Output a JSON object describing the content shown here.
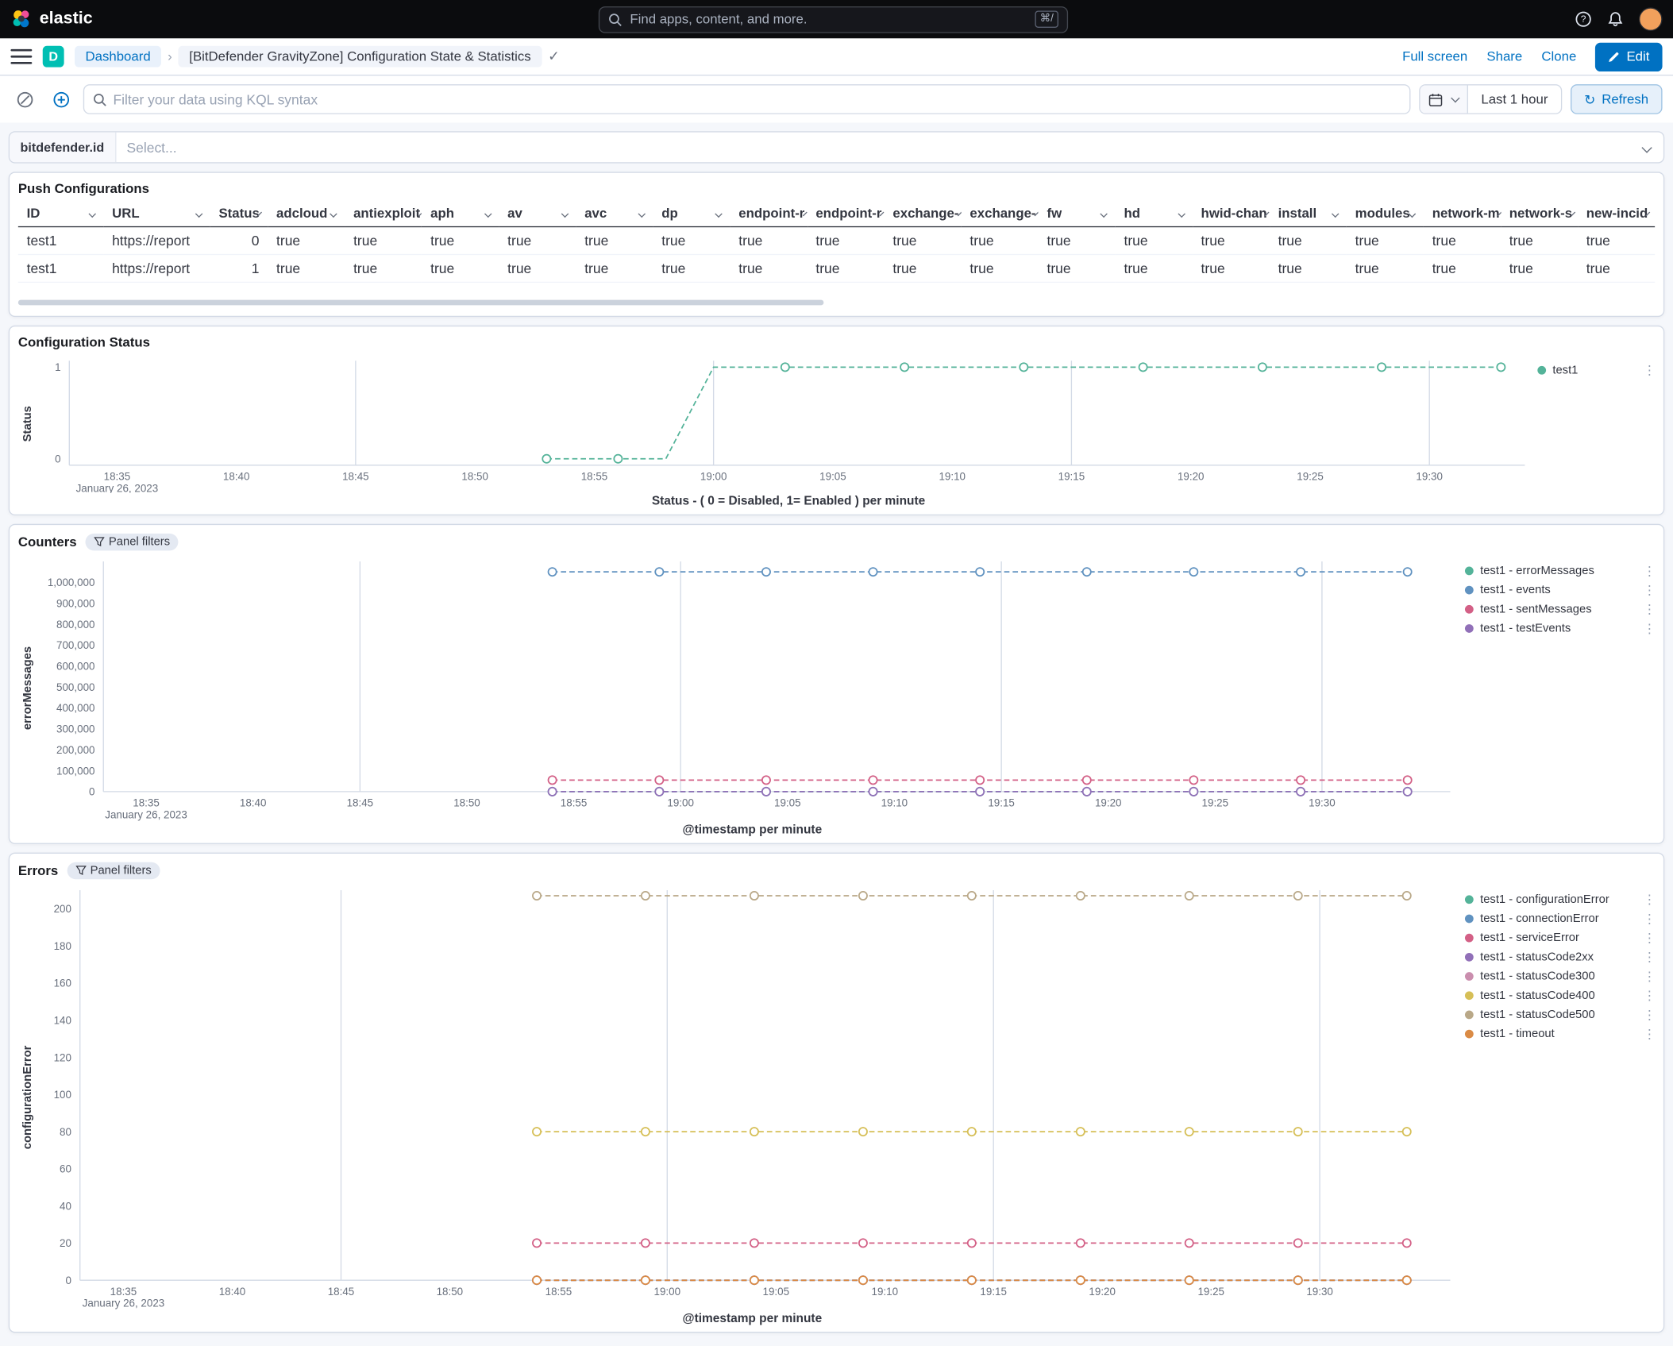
{
  "topbar": {
    "brand": "elastic",
    "search_placeholder": "Find apps, content, and more.",
    "search_shortcut": "⌘/"
  },
  "navbar": {
    "space_initial": "D",
    "breadcrumb_dashboard": "Dashboard",
    "breadcrumb_title": "[BitDefender GravityZone] Configuration State & Statistics",
    "full_screen": "Full screen",
    "share": "Share",
    "clone": "Clone",
    "edit": "Edit"
  },
  "filter_bar": {
    "kql_placeholder": "Filter your data using KQL syntax",
    "time_range": "Last 1 hour",
    "refresh": "Refresh"
  },
  "controls": {
    "field_label": "bitdefender.id",
    "placeholder": "Select..."
  },
  "icons": {
    "refresh": "↻",
    "check": "✓",
    "legend_actions": "⋮"
  },
  "push_configurations": {
    "title": "Push Configurations",
    "columns": [
      "ID",
      "URL",
      "Status",
      "adcloud",
      "antiexploit",
      "aph",
      "av",
      "avc",
      "dp",
      "endpoint-r",
      "endpoint-r",
      "exchange-",
      "exchange-",
      "fw",
      "hd",
      "hwid-chan",
      "install",
      "modules",
      "network-m",
      "network-s",
      "new-incid"
    ],
    "rows": [
      [
        "test1",
        "https://report",
        "0",
        "true",
        "true",
        "true",
        "true",
        "true",
        "true",
        "true",
        "true",
        "true",
        "true",
        "true",
        "true",
        "true",
        "true",
        "true",
        "true",
        "true",
        "true"
      ],
      [
        "test1",
        "https://report",
        "1",
        "true",
        "true",
        "true",
        "true",
        "true",
        "true",
        "true",
        "true",
        "true",
        "true",
        "true",
        "true",
        "true",
        "true",
        "true",
        "true",
        "true",
        "true"
      ]
    ]
  },
  "panels": {
    "status": {
      "title": "Configuration Status"
    },
    "counters": {
      "title": "Counters",
      "badge": "Panel filters"
    },
    "errors": {
      "title": "Errors",
      "badge": "Panel filters"
    }
  },
  "chart_data": [
    {
      "type": "line",
      "mount": "chart-status",
      "title": "Configuration Status",
      "ylabel": "Status",
      "xlabel": "Status - ( 0 = Disabled, 1= Enabled ) per minute",
      "y_ticks": [
        0,
        1
      ],
      "y_min": -0.07,
      "y_max": 1.07,
      "x_start": "18:33",
      "x_end": "19:34",
      "x_ticks": [
        "18:35",
        "18:40",
        "18:45",
        "18:50",
        "18:55",
        "19:00",
        "19:05",
        "19:10",
        "19:15",
        "19:20",
        "19:25",
        "19:30"
      ],
      "x_grid": [
        "18:45",
        "19:00",
        "19:15",
        "19:30"
      ],
      "x_sub": "January 26, 2023",
      "legend_position": "right",
      "series": [
        {
          "name": "test1",
          "color": "#54B399",
          "points": [
            [
              "18:53",
              0
            ],
            [
              "18:56",
              0
            ],
            [
              "18:58",
              0,
              0
            ],
            [
              "19:00",
              1,
              0
            ],
            [
              "19:03",
              1
            ],
            [
              "19:08",
              1
            ],
            [
              "19:13",
              1
            ],
            [
              "19:18",
              1
            ],
            [
              "19:23",
              1
            ],
            [
              "19:28",
              1
            ],
            [
              "19:33",
              1
            ]
          ]
        }
      ]
    },
    {
      "type": "line",
      "mount": "chart-counters",
      "title": "Counters",
      "ylabel": "errorMessages",
      "xlabel": "@timestamp per minute",
      "y_ticks": [
        0,
        100000,
        200000,
        300000,
        400000,
        500000,
        600000,
        700000,
        800000,
        900000,
        1000000
      ],
      "y_min": 0,
      "y_max": 1100000,
      "x_start": "18:33",
      "x_end": "19:36",
      "x_ticks": [
        "18:35",
        "18:40",
        "18:45",
        "18:50",
        "18:55",
        "19:00",
        "19:05",
        "19:10",
        "19:15",
        "19:20",
        "19:25",
        "19:30"
      ],
      "x_grid": [
        "18:45",
        "19:00",
        "19:15",
        "19:30"
      ],
      "x_sub": "January 26, 2023",
      "legend_position": "right",
      "x": [
        "18:54",
        "18:59",
        "19:04",
        "19:09",
        "19:14",
        "19:19",
        "19:24",
        "19:29",
        "19:34"
      ],
      "series": [
        {
          "name": "test1 - errorMessages",
          "color": "#54B399",
          "values": [
            0,
            0,
            0,
            0,
            0,
            0,
            0,
            0,
            0
          ]
        },
        {
          "name": "test1 - events",
          "color": "#6092C0",
          "values": [
            1050000,
            1050000,
            1050000,
            1050000,
            1050000,
            1050000,
            1050000,
            1050000,
            1050000
          ]
        },
        {
          "name": "test1 - sentMessages",
          "color": "#D36086",
          "values": [
            55000,
            55000,
            55000,
            55000,
            55000,
            55000,
            55000,
            55000,
            55000
          ]
        },
        {
          "name": "test1 - testEvents",
          "color": "#9170B8",
          "values": [
            0,
            0,
            0,
            0,
            0,
            0,
            0,
            0,
            0
          ]
        }
      ]
    },
    {
      "type": "line",
      "mount": "chart-errors",
      "title": "Errors",
      "ylabel": "configurationError",
      "xlabel": "@timestamp per minute",
      "y_ticks": [
        0,
        20,
        40,
        60,
        80,
        100,
        120,
        140,
        160,
        180,
        200
      ],
      "y_min": 0,
      "y_max": 210,
      "x_start": "18:33",
      "x_end": "19:36",
      "x_ticks": [
        "18:35",
        "18:40",
        "18:45",
        "18:50",
        "18:55",
        "19:00",
        "19:05",
        "19:10",
        "19:15",
        "19:20",
        "19:25",
        "19:30"
      ],
      "x_grid": [
        "18:45",
        "19:00",
        "19:15",
        "19:30"
      ],
      "x_sub": "January 26, 2023",
      "legend_position": "right",
      "x": [
        "18:54",
        "18:59",
        "19:04",
        "19:09",
        "19:14",
        "19:19",
        "19:24",
        "19:29",
        "19:34"
      ],
      "series": [
        {
          "name": "test1 - configurationError",
          "color": "#54B399",
          "values": [
            0,
            0,
            0,
            0,
            0,
            0,
            0,
            0,
            0
          ]
        },
        {
          "name": "test1 - connectionError",
          "color": "#6092C0",
          "values": [
            0,
            0,
            0,
            0,
            0,
            0,
            0,
            0,
            0
          ]
        },
        {
          "name": "test1 - serviceError",
          "color": "#D36086",
          "values": [
            20,
            20,
            20,
            20,
            20,
            20,
            20,
            20,
            20
          ]
        },
        {
          "name": "test1 - statusCode2xx",
          "color": "#9170B8",
          "values": [
            0,
            0,
            0,
            0,
            0,
            0,
            0,
            0,
            0
          ]
        },
        {
          "name": "test1 - statusCode300",
          "color": "#CA8EAE",
          "values": [
            0,
            0,
            0,
            0,
            0,
            0,
            0,
            0,
            0
          ]
        },
        {
          "name": "test1 - statusCode400",
          "color": "#D6BF57",
          "values": [
            80,
            80,
            80,
            80,
            80,
            80,
            80,
            80,
            80
          ]
        },
        {
          "name": "test1 - statusCode500",
          "color": "#B9A888",
          "values": [
            207,
            207,
            207,
            207,
            207,
            207,
            207,
            207,
            207
          ]
        },
        {
          "name": "test1 - timeout",
          "color": "#DA8B45",
          "values": [
            0,
            0,
            0,
            0,
            0,
            0,
            0,
            0,
            0
          ]
        }
      ]
    }
  ]
}
